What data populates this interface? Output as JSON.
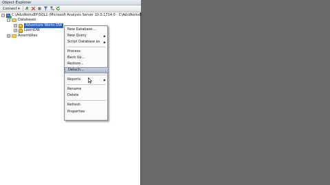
{
  "panel": {
    "title": "Object Explorer"
  },
  "toolbar": {
    "connect_label": "Connect ▾"
  },
  "tree": {
    "server_label": "C:\\AdvWorksEP\\SQL1 (Microsoft Analysis Server 10.0.1714.0 - C\\AdvWorksEP\\SQL1\\admin)",
    "databases_label": "Databases",
    "db1_label": "Adventure Works DW",
    "db2_label": "LearnDW",
    "assemblies_label": "Assemblies"
  },
  "context_menu": {
    "items": [
      "New Database...",
      "New Query",
      "Script Database as",
      "Process",
      "Back Up...",
      "Restore...",
      "Detach...",
      "Reports",
      "Rename",
      "Delete",
      "Refresh",
      "Properties"
    ],
    "highlighted": "Detach..."
  },
  "colors": {
    "selection": "#2d5dbb",
    "menu_highlight": "#b8c0d4",
    "background": "#6b6b6b"
  }
}
